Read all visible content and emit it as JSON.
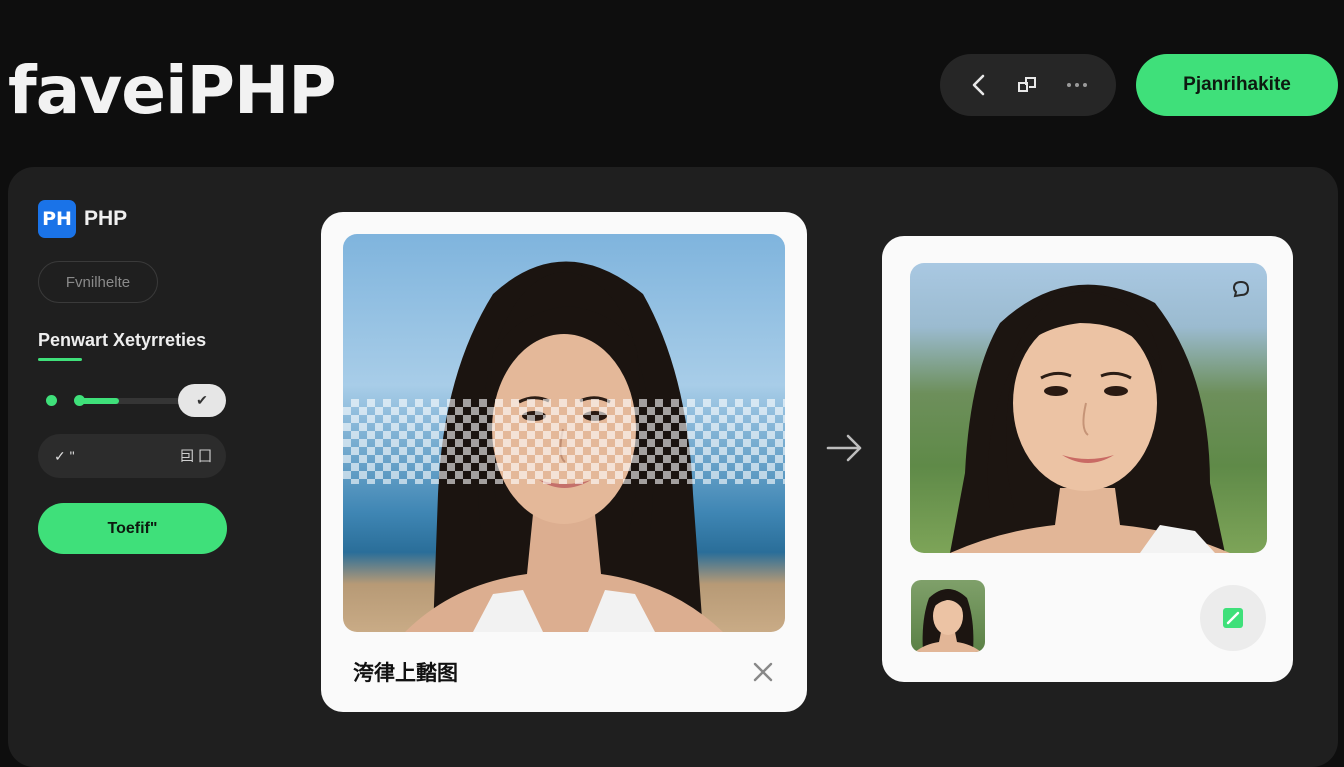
{
  "header": {
    "brand": "faveiPHP",
    "nav_icons": [
      "back-arrow-icon",
      "share-icon",
      "more-icon"
    ],
    "cta_label": "Pjanrihakite"
  },
  "sidebar": {
    "logo_mark": "PH",
    "logo_text": "PHP",
    "pill_label": "Fvnilhelte",
    "section_title": "Penwart Xetyrreties",
    "slider_button_text": "✔",
    "slider_value": 0.3,
    "option_left_text": "✓ \"",
    "option_right_text": "囙 囗",
    "action_label": "Toefif\""
  },
  "upload": {
    "label": "洿律上濌图",
    "close_icon": "close-icon"
  },
  "result": {
    "chat_icon": "chat-icon",
    "confirm_icon": "check-square-icon"
  },
  "colors": {
    "accent": "#3fe07a",
    "background": "#0e0e0e",
    "panel": "#1f1f1f",
    "card": "#fafafa"
  }
}
